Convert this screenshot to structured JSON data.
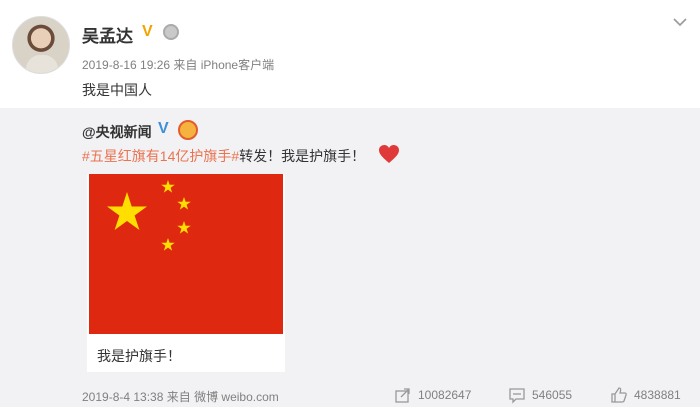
{
  "post": {
    "author": "吴孟达",
    "vip_mark": "V",
    "meta": "2019-8-16 19:26 来自 iPhone客户端",
    "text": "我是中国人"
  },
  "repost": {
    "author": "@央视新闻",
    "verified_mark": "V",
    "topic": "#五星红旗有14亿护旗手#",
    "text_after_topic": "转发！我是护旗手！",
    "image_caption": "我是护旗手！",
    "meta": "2019-8-4 13:38 来自 微博 weibo.com",
    "stats": {
      "reposts": "10082647",
      "comments": "546055",
      "likes": "4838881"
    }
  },
  "colors": {
    "topic": "#eb7350",
    "flag_red": "#de2910",
    "flag_star": "#ffde00",
    "repost_bg": "#f2f2f5",
    "verified": "#3d8fd8",
    "vip": "#f0a500"
  }
}
